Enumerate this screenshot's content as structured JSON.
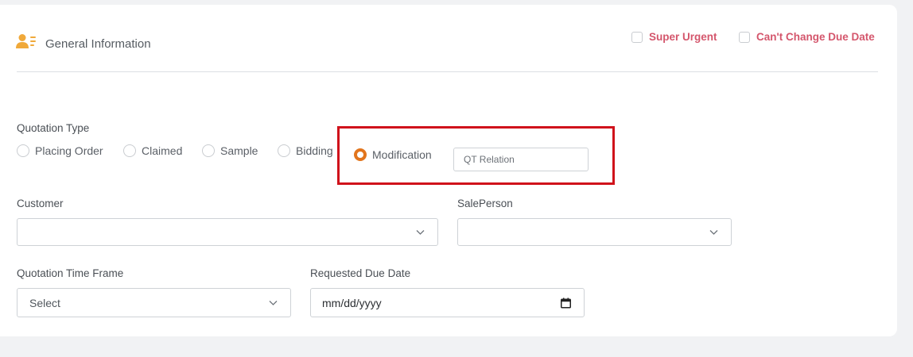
{
  "header": {
    "title": "General Information",
    "icon": "user-list-icon",
    "flags": [
      {
        "label": "Super Urgent",
        "checked": false
      },
      {
        "label": "Can't Change Due Date",
        "checked": false
      }
    ]
  },
  "quotation_type": {
    "label": "Quotation Type",
    "options": [
      {
        "label": "Placing Order",
        "selected": false
      },
      {
        "label": "Claimed",
        "selected": false
      },
      {
        "label": "Sample",
        "selected": false
      },
      {
        "label": "Bidding",
        "selected": false
      },
      {
        "label": "Modification",
        "selected": true
      }
    ],
    "qt_relation": {
      "value": "",
      "placeholder": "QT Relation"
    }
  },
  "customer": {
    "label": "Customer",
    "value": ""
  },
  "sale_person": {
    "label": "SalePerson",
    "value": ""
  },
  "time_frame": {
    "label": "Quotation Time Frame",
    "value": "Select"
  },
  "due_date": {
    "label": "Requested Due Date",
    "value": "mm/dd/yyyy"
  },
  "colors": {
    "accent": "#e2751d",
    "flag_text": "#d4566c",
    "highlight": "#d0121b",
    "icon": "#f0a93a"
  }
}
